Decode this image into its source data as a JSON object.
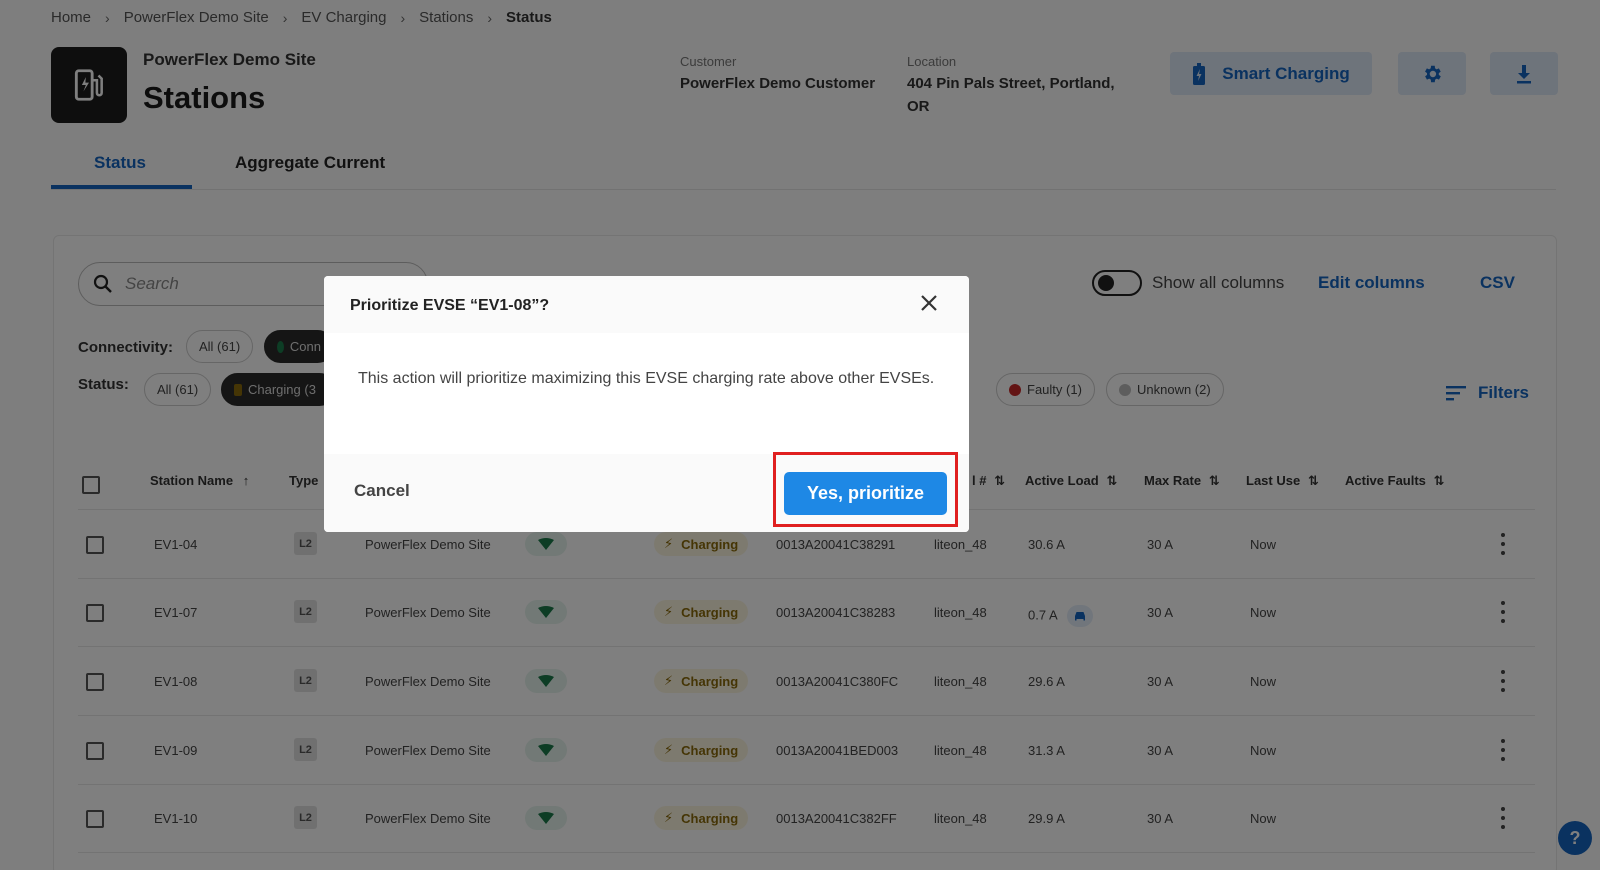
{
  "breadcrumb": [
    "Home",
    "PowerFlex Demo Site",
    "EV Charging",
    "Stations",
    "Status"
  ],
  "header": {
    "site_name": "PowerFlex Demo Site",
    "title": "Stations",
    "customer_label": "Customer",
    "customer_value": "PowerFlex Demo Customer",
    "location_label": "Location",
    "location_line1": "404 Pin Pals Street, Portland,",
    "location_line2": "OR",
    "smart_charging_label": "Smart Charging"
  },
  "tabs": [
    {
      "label": "Status",
      "active": true
    },
    {
      "label": "Aggregate Current",
      "active": false
    }
  ],
  "toolbar": {
    "search_placeholder": "Search",
    "show_all_columns": "Show all columns",
    "edit_columns": "Edit columns",
    "csv": "CSV",
    "filters": "Filters"
  },
  "filters": {
    "connectivity_label": "Connectivity:",
    "connectivity_all": "All (61)",
    "connectivity_connected": "Conn",
    "status_label": "Status:",
    "status_all": "All (61)",
    "status_charging": "Charging (3",
    "status_paren": ")",
    "status_faulty": "Faulty (1)",
    "status_unknown": "Unknown (2)"
  },
  "table": {
    "headers": {
      "station_name": "Station Name",
      "type": "Type",
      "serial_partial": "l #",
      "active_load": "Active Load",
      "max_rate": "Max Rate",
      "last_use": "Last Use",
      "active_faults": "Active Faults"
    },
    "rows": [
      {
        "name": "EV1-04",
        "type": "L2",
        "site": "PowerFlex Demo Site",
        "status": "Charging",
        "serial": "0013A20041C38291",
        "model": "liteon_48",
        "load": "30.6 A",
        "max_rate": "30 A",
        "last_use": "Now"
      },
      {
        "name": "EV1-07",
        "type": "L2",
        "site": "PowerFlex Demo Site",
        "status": "Charging",
        "serial": "0013A20041C38283",
        "model": "liteon_48",
        "load": "0.7 A",
        "max_rate": "30 A",
        "last_use": "Now"
      },
      {
        "name": "EV1-08",
        "type": "L2",
        "site": "PowerFlex Demo Site",
        "status": "Charging",
        "serial": "0013A20041C380FC",
        "model": "liteon_48",
        "load": "29.6 A",
        "max_rate": "30 A",
        "last_use": "Now"
      },
      {
        "name": "EV1-09",
        "type": "L2",
        "site": "PowerFlex Demo Site",
        "status": "Charging",
        "serial": "0013A20041BED003",
        "model": "liteon_48",
        "load": "31.3 A",
        "max_rate": "30 A",
        "last_use": "Now"
      },
      {
        "name": "EV1-10",
        "type": "L2",
        "site": "PowerFlex Demo Site",
        "status": "Charging",
        "serial": "0013A20041C382FF",
        "model": "liteon_48",
        "load": "29.9 A",
        "max_rate": "30 A",
        "last_use": "Now"
      }
    ]
  },
  "modal": {
    "title": "Prioritize EVSE “EV1-08”?",
    "body": "This action will prioritize maximizing this EVSE charging rate above other EVSEs.",
    "cancel_label": "Cancel",
    "confirm_label": "Yes, prioritize"
  },
  "help_label": "?",
  "colors": {
    "accent": "#1565c0",
    "confirm": "#1e88e5",
    "highlight": "#e02020",
    "charging": "#8a6a0a",
    "connected": "#1b7a4a",
    "faulty": "#c62828"
  }
}
